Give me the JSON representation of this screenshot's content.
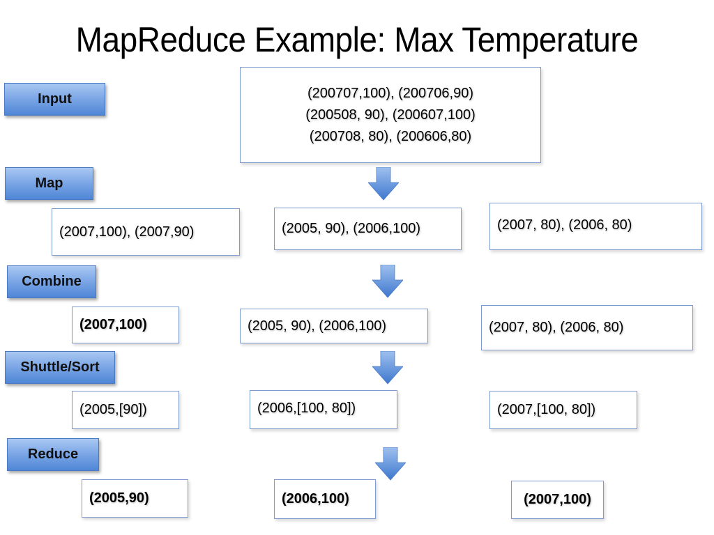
{
  "title": "MapReduce Example: Max Temperature",
  "stages": {
    "input": "Input",
    "map": "Map",
    "combine": "Combine",
    "shuffle": "Shuttle/Sort",
    "reduce": "Reduce"
  },
  "input_records": [
    "(200707,100), (200706,90)",
    "(200508, 90), (200607,100)",
    "(200708, 80), (200606,80)"
  ],
  "map_outputs": [
    "(2007,100), (2007,90)",
    "(2005, 90), (2006,100)",
    "(2007, 80), (2006, 80)"
  ],
  "combine_outputs": [
    "(2007,100)",
    "(2005, 90), (2006,100)",
    "(2007, 80), (2006, 80)"
  ],
  "shuffle_outputs": [
    "(2005,[90])",
    "(2006,[100, 80])",
    "(2007,[100, 80])"
  ],
  "reduce_outputs": [
    "(2005,90)",
    "(2006,100)",
    "(2007,100)"
  ],
  "colors": {
    "stage_fill_top": "#a9c8f2",
    "stage_fill_bottom": "#4f86d6",
    "box_border": "#7c9ad0",
    "arrow_fill": "#5b8fdc"
  }
}
